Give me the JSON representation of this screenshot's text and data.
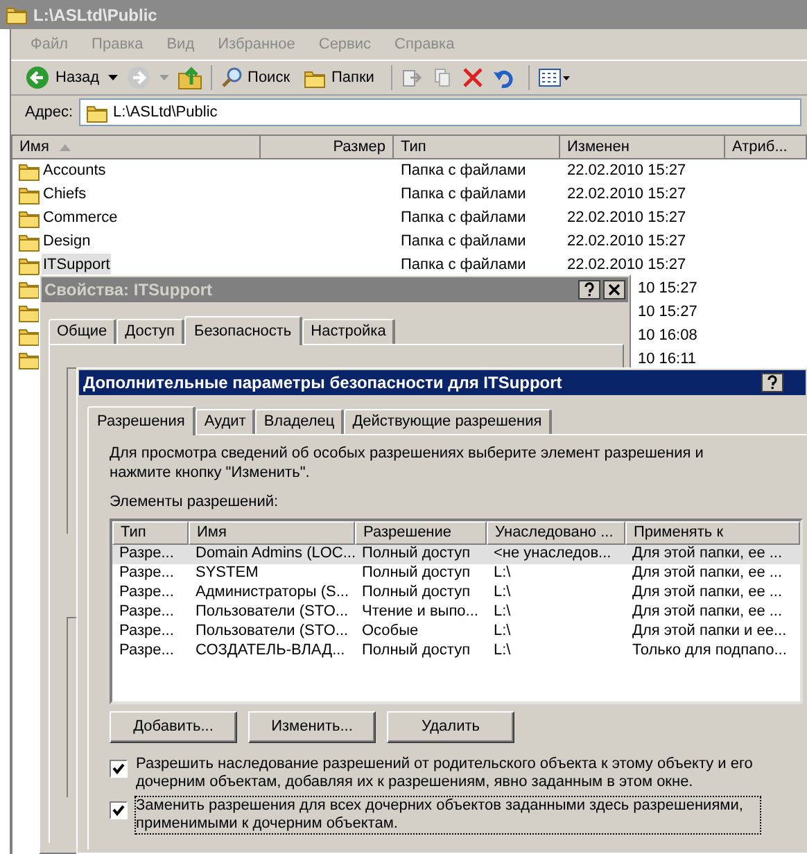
{
  "explorer": {
    "title": "L:\\ASLtd\\Public",
    "menu": [
      "Файл",
      "Правка",
      "Вид",
      "Избранное",
      "Сервис",
      "Справка"
    ],
    "toolbar": {
      "back": "Назад",
      "search": "Поиск",
      "folders": "Папки"
    },
    "address": {
      "label": "Адрес:",
      "value": "L:\\ASLtd\\Public"
    },
    "columns": [
      "Имя",
      "Размер",
      "Тип",
      "Изменен",
      "Атриб..."
    ],
    "rows": [
      {
        "name": "Accounts",
        "type": "Папка с файлами",
        "modified": "22.02.2010 15:27",
        "selected": false
      },
      {
        "name": "Chiefs",
        "type": "Папка с файлами",
        "modified": "22.02.2010 15:27",
        "selected": false
      },
      {
        "name": "Commerce",
        "type": "Папка с файлами",
        "modified": "22.02.2010 15:27",
        "selected": false
      },
      {
        "name": "Design",
        "type": "Папка с файлами",
        "modified": "22.02.2010 15:27",
        "selected": false
      },
      {
        "name": "ITSupport",
        "type": "Папка с файлами",
        "modified": "22.02.2010 15:27",
        "selected": true
      }
    ],
    "partly_hidden_rows": [
      {
        "modified": "10 15:27"
      },
      {
        "modified": "10 15:27"
      },
      {
        "modified": "10 16:08"
      },
      {
        "modified": "10 16:11"
      }
    ]
  },
  "properties": {
    "title": "Свойства: ITSupport",
    "tabs": [
      {
        "label": "Общие",
        "selected": false
      },
      {
        "label": "Доступ",
        "selected": false
      },
      {
        "label": "Безопасность",
        "selected": true
      },
      {
        "label": "Настройка",
        "selected": false
      }
    ]
  },
  "advanced": {
    "title": "Дополнительные параметры безопасности для ITSupport",
    "tabs": [
      {
        "label": "Разрешения",
        "selected": true
      },
      {
        "label": "Аудит",
        "selected": false
      },
      {
        "label": "Владелец",
        "selected": false
      },
      {
        "label": "Действующие разрешения",
        "selected": false
      }
    ],
    "instructions": "Для просмотра сведений об особых разрешениях выберите элемент разрешения и нажмите кнопку \"Изменить\".",
    "list_label": "Элементы разрешений:",
    "columns": [
      "Тип",
      "Имя",
      "Разрешение",
      "Унаследовано ...",
      "Применять к"
    ],
    "entries": [
      {
        "type": "Разре...",
        "name": "Domain Admins (LOC...",
        "permission": "Полный доступ",
        "inherited": "<не унаследов...",
        "apply_to": "Для этой папки, ее ...",
        "selected": true
      },
      {
        "type": "Разре...",
        "name": "SYSTEM",
        "permission": "Полный доступ",
        "inherited": "L:\\",
        "apply_to": "Для этой папки, ее ...",
        "selected": false
      },
      {
        "type": "Разре...",
        "name": "Администраторы (S...",
        "permission": "Полный доступ",
        "inherited": "L:\\",
        "apply_to": "Для этой папки, ее ...",
        "selected": false
      },
      {
        "type": "Разре...",
        "name": "Пользователи (STO...",
        "permission": "Чтение и выпо...",
        "inherited": "L:\\",
        "apply_to": "Для этой папки, ее ...",
        "selected": false
      },
      {
        "type": "Разре...",
        "name": "Пользователи (STO...",
        "permission": "Особые",
        "inherited": "L:\\",
        "apply_to": "Для этой папки и ее...",
        "selected": false
      },
      {
        "type": "Разре...",
        "name": "СОЗДАТЕЛЬ-ВЛАД...",
        "permission": "Полный доступ",
        "inherited": "L:\\",
        "apply_to": "Только для подпапо...",
        "selected": false
      }
    ],
    "buttons": [
      "Добавить...",
      "Изменить...",
      "Удалить"
    ],
    "options": [
      {
        "label": "Разрешить наследование разрешений от родительского объекта к этому объекту и его дочерним объектам, добавляя их к разрешениям, явно заданным в этом окне.",
        "checked": true,
        "focused": false
      },
      {
        "label": "Заменить разрешения для всех дочерних объектов заданными здесь разрешениями, применимыми к дочерним объектам.",
        "checked": true,
        "focused": true
      }
    ]
  }
}
